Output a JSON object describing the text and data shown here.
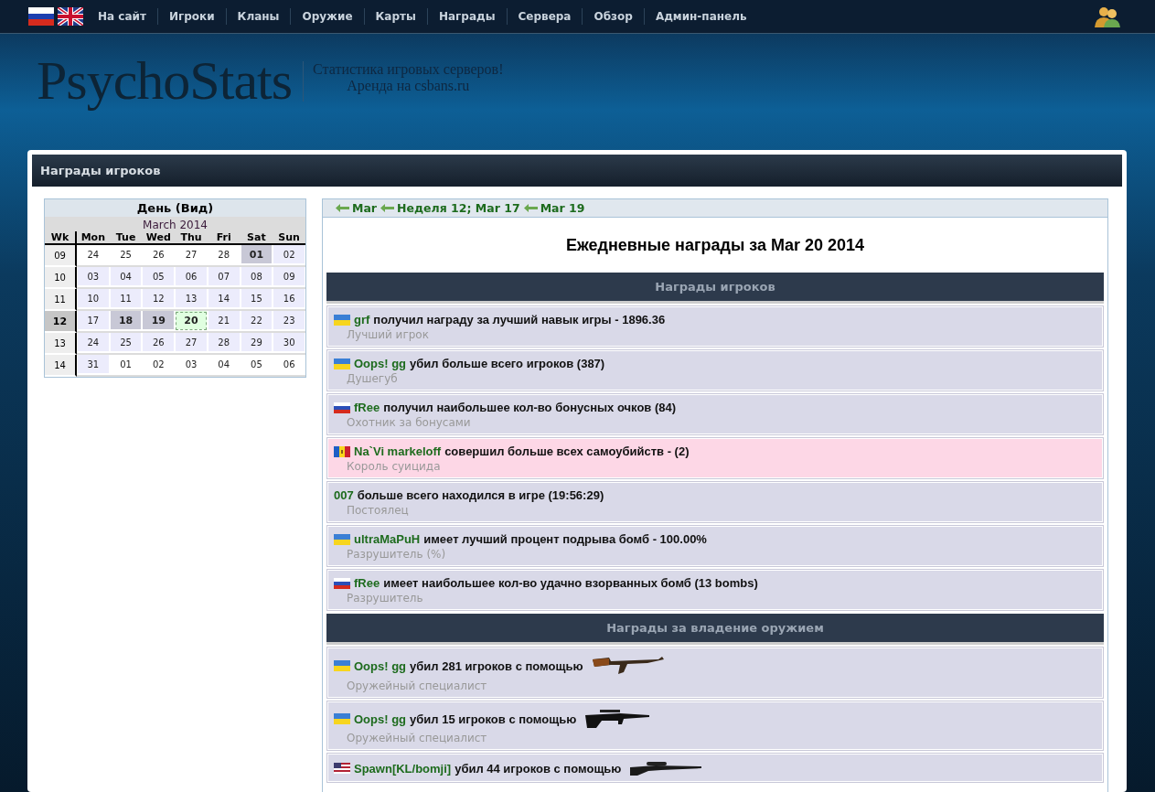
{
  "nav": {
    "items": [
      "На сайт",
      "Игроки",
      "Кланы",
      "Оружие",
      "Карты",
      "Награды",
      "Сервера",
      "Обзор",
      "Админ-панель"
    ]
  },
  "header": {
    "logo": "PsychoStats",
    "tagline_1": "Статистика игровых серверов!",
    "tagline_2": "Аренда на csbans.ru"
  },
  "panel": {
    "title": "Награды игроков"
  },
  "calendar": {
    "title": "День (Вид)",
    "month": "March 2014",
    "columns": [
      "Wk",
      "Mon",
      "Tue",
      "Wed",
      "Thu",
      "Fri",
      "Sat",
      "Sun"
    ],
    "weeks": [
      {
        "week": "09",
        "highlighted": false,
        "days": [
          {
            "label": "24",
            "in_month": false,
            "highlighted": false,
            "selected": false
          },
          {
            "label": "25",
            "in_month": false,
            "highlighted": false,
            "selected": false
          },
          {
            "label": "26",
            "in_month": false,
            "highlighted": false,
            "selected": false
          },
          {
            "label": "27",
            "in_month": false,
            "highlighted": false,
            "selected": false
          },
          {
            "label": "28",
            "in_month": false,
            "highlighted": false,
            "selected": false
          },
          {
            "label": "01",
            "in_month": true,
            "highlighted": true,
            "selected": false
          },
          {
            "label": "02",
            "in_month": true,
            "highlighted": false,
            "selected": false
          }
        ]
      },
      {
        "week": "10",
        "highlighted": false,
        "days": [
          {
            "label": "03",
            "in_month": true,
            "highlighted": false,
            "selected": false
          },
          {
            "label": "04",
            "in_month": true,
            "highlighted": false,
            "selected": false
          },
          {
            "label": "05",
            "in_month": true,
            "highlighted": false,
            "selected": false
          },
          {
            "label": "06",
            "in_month": true,
            "highlighted": false,
            "selected": false
          },
          {
            "label": "07",
            "in_month": true,
            "highlighted": false,
            "selected": false
          },
          {
            "label": "08",
            "in_month": true,
            "highlighted": false,
            "selected": false
          },
          {
            "label": "09",
            "in_month": true,
            "highlighted": false,
            "selected": false
          }
        ]
      },
      {
        "week": "11",
        "highlighted": false,
        "days": [
          {
            "label": "10",
            "in_month": true,
            "highlighted": false,
            "selected": false
          },
          {
            "label": "11",
            "in_month": true,
            "highlighted": false,
            "selected": false
          },
          {
            "label": "12",
            "in_month": true,
            "highlighted": false,
            "selected": false
          },
          {
            "label": "13",
            "in_month": true,
            "highlighted": false,
            "selected": false
          },
          {
            "label": "14",
            "in_month": true,
            "highlighted": false,
            "selected": false
          },
          {
            "label": "15",
            "in_month": true,
            "highlighted": false,
            "selected": false
          },
          {
            "label": "16",
            "in_month": true,
            "highlighted": false,
            "selected": false
          }
        ]
      },
      {
        "week": "12",
        "highlighted": true,
        "days": [
          {
            "label": "17",
            "in_month": true,
            "highlighted": false,
            "selected": false
          },
          {
            "label": "18",
            "in_month": true,
            "highlighted": true,
            "selected": false
          },
          {
            "label": "19",
            "in_month": true,
            "highlighted": true,
            "selected": false
          },
          {
            "label": "20",
            "in_month": true,
            "highlighted": false,
            "selected": true
          },
          {
            "label": "21",
            "in_month": true,
            "highlighted": false,
            "selected": false
          },
          {
            "label": "22",
            "in_month": true,
            "highlighted": false,
            "selected": false
          },
          {
            "label": "23",
            "in_month": true,
            "highlighted": false,
            "selected": false
          }
        ]
      },
      {
        "week": "13",
        "highlighted": false,
        "days": [
          {
            "label": "24",
            "in_month": true,
            "highlighted": false,
            "selected": false
          },
          {
            "label": "25",
            "in_month": true,
            "highlighted": false,
            "selected": false
          },
          {
            "label": "26",
            "in_month": true,
            "highlighted": false,
            "selected": false
          },
          {
            "label": "27",
            "in_month": true,
            "highlighted": false,
            "selected": false
          },
          {
            "label": "28",
            "in_month": true,
            "highlighted": false,
            "selected": false
          },
          {
            "label": "29",
            "in_month": true,
            "highlighted": false,
            "selected": false
          },
          {
            "label": "30",
            "in_month": true,
            "highlighted": false,
            "selected": false
          }
        ]
      },
      {
        "week": "14",
        "highlighted": false,
        "days": [
          {
            "label": "31",
            "in_month": true,
            "highlighted": false,
            "selected": false
          },
          {
            "label": "01",
            "in_month": false,
            "highlighted": false,
            "selected": false
          },
          {
            "label": "02",
            "in_month": false,
            "highlighted": false,
            "selected": false
          },
          {
            "label": "03",
            "in_month": false,
            "highlighted": false,
            "selected": false
          },
          {
            "label": "04",
            "in_month": false,
            "highlighted": false,
            "selected": false
          },
          {
            "label": "05",
            "in_month": false,
            "highlighted": false,
            "selected": false
          },
          {
            "label": "06",
            "in_month": false,
            "highlighted": false,
            "selected": false
          }
        ]
      }
    ]
  },
  "breadcrumbs": [
    "Mar",
    "Неделя 12; Mar 17",
    "Mar 19"
  ],
  "heading": "Ежедневные награды за Mar 20 2014",
  "sections": [
    {
      "title": "Награды игроков",
      "awards": [
        {
          "flag": {
            "kind": "ua"
          },
          "player": "grf",
          "text": "получил награду за лучший навык игры - 1896.36",
          "award": "Лучший игрок",
          "negative": false
        },
        {
          "flag": {
            "kind": "ua"
          },
          "player": "Oops! gg",
          "text": "убил больше всего игроков (387)",
          "award": "Душегуб",
          "negative": false
        },
        {
          "flag": {
            "kind": "ru"
          },
          "player": "fRee",
          "text": "получил наибольшее кол-во бонусных очков (84)",
          "award": "Охотник за бонусами",
          "negative": false
        },
        {
          "flag": {
            "kind": "md"
          },
          "player": "Na`Vi markeloff",
          "text": "совершил больше всех самоубийств - (2)",
          "award": "Король суицида",
          "negative": true
        },
        {
          "player": "007",
          "text": "больше всего находился в игре (19:56:29)",
          "award": "Постоялец",
          "negative": false
        },
        {
          "flag": {
            "kind": "ua"
          },
          "player": "ultraMaPuH",
          "text": "имеет лучший процент подрыва бомб - 100.00%",
          "award": "Разрушитель (%)",
          "negative": false
        },
        {
          "flag": {
            "kind": "ru"
          },
          "player": "fRee",
          "text": "имеет наибольшее кол-во удачно взорванных бомб (13 bombs)",
          "award": "Разрушитель",
          "negative": false
        }
      ]
    },
    {
      "title": "Награды за владение оружием",
      "awards": [
        {
          "flag": {
            "kind": "ua"
          },
          "player": "Oops! gg",
          "text": "убил 281 игроков с помощью",
          "weapon": {
            "kind": "ak"
          },
          "award": "Оружейный специалист",
          "negative": false
        },
        {
          "flag": {
            "kind": "ua"
          },
          "player": "Oops! gg",
          "text": "убил 15 игроков с помощью",
          "weapon": {
            "kind": "bullpup"
          },
          "award": "Оружейный специалист",
          "negative": false
        },
        {
          "flag": {
            "kind": "us"
          },
          "player": "Spawn[KL/bomji]",
          "text": "убил 44 игроков с помощью",
          "weapon": {
            "kind": "sniper"
          },
          "negative": false
        }
      ]
    }
  ]
}
